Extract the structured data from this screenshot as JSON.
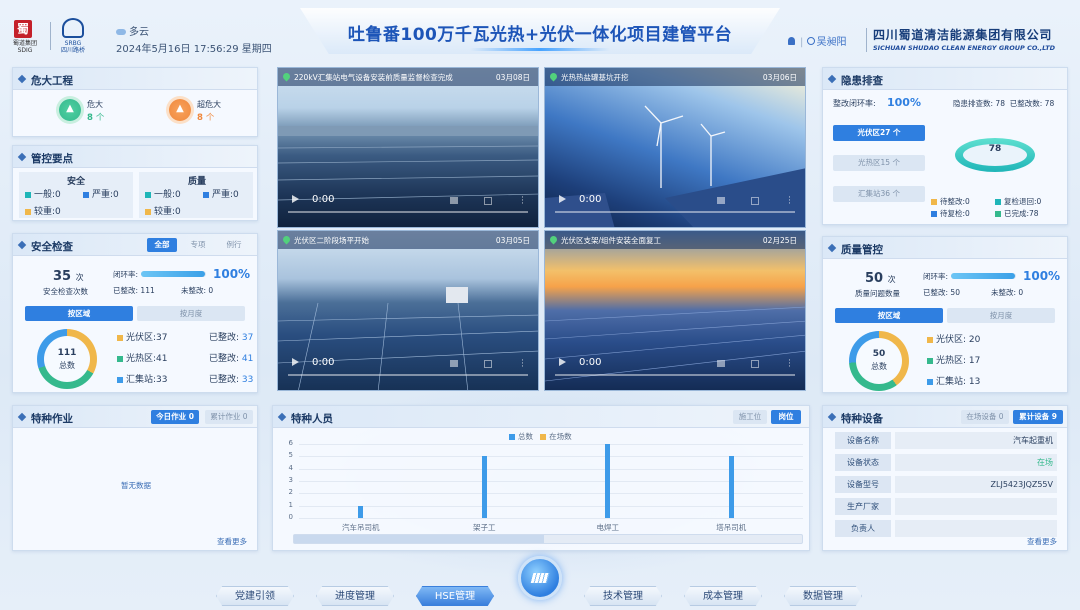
{
  "header": {
    "logo1_text": "蜀道集团\nSDIG",
    "logo1_glyph": "蜀",
    "logo2_text": "SRBG\n四川路桥",
    "weather": "多云",
    "datetime": "2024年5月16日 17:56:29 星期四",
    "title": "吐鲁番100万千瓦光热+光伏一体化项目建管平台",
    "user": "吴昶阳",
    "company": "四川蜀道清洁能源集团有限公司",
    "company_en": "SICHUAN SHUDAO CLEAN ENERGY GROUP CO.,LTD"
  },
  "major": {
    "title": "危大工程",
    "items": [
      {
        "label": "危大",
        "count": "8",
        "unit": "个",
        "color": "#35b98d"
      },
      {
        "label": "超危大",
        "count": "8",
        "unit": "个",
        "color": "#f0883c"
      }
    ]
  },
  "control": {
    "title": "管控要点",
    "safety": {
      "head": "安全",
      "general": "一般:0",
      "serious": "严重:0",
      "major": "较重:0"
    },
    "quality": {
      "head": "质量",
      "general": "一般:0",
      "serious": "严重:0",
      "major": "较重:0"
    }
  },
  "safety_check": {
    "title": "安全检查",
    "tabs": [
      "全部",
      "专项",
      "例行"
    ],
    "count": "35",
    "count_unit": "次",
    "count_label": "安全检查次数",
    "close_label": "闭环率:",
    "close_rate": 0.98,
    "close_pct": "100%",
    "rectified": "已整改:",
    "rectified_val": "111",
    "pending": "未整改:",
    "pending_val": "0",
    "subtabs": [
      "按区域",
      "按月度"
    ],
    "donut_val": "111",
    "donut_label": "总数",
    "rows": [
      {
        "name": "光伏区:37",
        "done": "已整改:",
        "num": "37"
      },
      {
        "name": "光热区:41",
        "done": "已整改:",
        "num": "41"
      },
      {
        "name": "汇集站:33",
        "done": "已整改:",
        "num": "33"
      }
    ]
  },
  "special_work": {
    "title": "特种作业",
    "btn_today": "今日作业 0",
    "btn_total": "累计作业 0",
    "empty": "暂无数据",
    "more": "查看更多"
  },
  "videos": [
    {
      "title": "220kV汇集站电气设备安装前质量监督检查完成",
      "date": "03月08日",
      "time": "0:00"
    },
    {
      "title": "光热热盐罐基坑开挖",
      "date": "03月06日",
      "time": "0:00"
    },
    {
      "title": "光伏区二阶段场平开始",
      "date": "03月05日",
      "time": "0:00"
    },
    {
      "title": "光伏区支架/组件安装全面复工",
      "date": "02月25日",
      "time": "0:00"
    }
  ],
  "personnel": {
    "title": "特种人员",
    "btn1": "施工位",
    "btn2": "岗位",
    "legend": [
      "总数",
      "在场数"
    ],
    "legend_colors": [
      "#3d9be9",
      "#f0b74a"
    ]
  },
  "chart_data": {
    "type": "bar",
    "title": "",
    "categories": [
      "汽车吊司机",
      "架子工",
      "电焊工",
      "塔吊司机"
    ],
    "series": [
      {
        "name": "总数",
        "values": [
          1,
          5,
          6,
          5
        ]
      },
      {
        "name": "在场数",
        "values": [
          0,
          0,
          0,
          0
        ]
      }
    ],
    "ylim": [
      0,
      6
    ],
    "yticks": [
      "0",
      "1",
      "2",
      "3",
      "4",
      "5",
      "6"
    ],
    "xlabel": "",
    "ylabel": ""
  },
  "hazard": {
    "title": "隐患排查",
    "close_label": "整改闭环率:",
    "close_val": "100%",
    "total_label": "隐患排查数:",
    "total_val": "78",
    "fixed_label": "已整改数:",
    "fixed_val": "78",
    "areas": [
      "光伏区27 个",
      "光热区15 个",
      "汇集站36 个"
    ],
    "donut_val": "78",
    "legend": [
      "待整改:0",
      "复检退回:0",
      "待复检:0",
      "已完成:78"
    ],
    "legend_colors": [
      "#f0b74a",
      "#1fb5b8",
      "#2f7fe0",
      "#35b98d"
    ]
  },
  "quality": {
    "title": "质量管控",
    "count": "50",
    "count_unit": "次",
    "count_label": "质量问题数量",
    "close_label": "闭环率:",
    "close_rate": 0.98,
    "close_pct": "100%",
    "rectified": "已整改:",
    "rectified_val": "50",
    "pending": "未整改:",
    "pending_val": "0",
    "subtabs": [
      "按区域",
      "按月度"
    ],
    "donut_val": "50",
    "donut_label": "总数",
    "rows": [
      "光伏区: 20",
      "光热区: 17",
      "汇集站: 13"
    ]
  },
  "equipment": {
    "title": "特种设备",
    "btn1": "在场设备 0",
    "btn2": "累计设备 9",
    "rows": [
      {
        "k": "设备名称",
        "v": "汽车起重机"
      },
      {
        "k": "设备状态",
        "v": "在场"
      },
      {
        "k": "设备型号",
        "v": "ZLJ5423JQZ55V"
      },
      {
        "k": "生产厂家",
        "v": ""
      },
      {
        "k": "负责人",
        "v": ""
      }
    ],
    "more": "查看更多"
  },
  "nav": [
    "党建引领",
    "进度管理",
    "HSE管理",
    "技术管理",
    "成本管理",
    "数据管理"
  ]
}
